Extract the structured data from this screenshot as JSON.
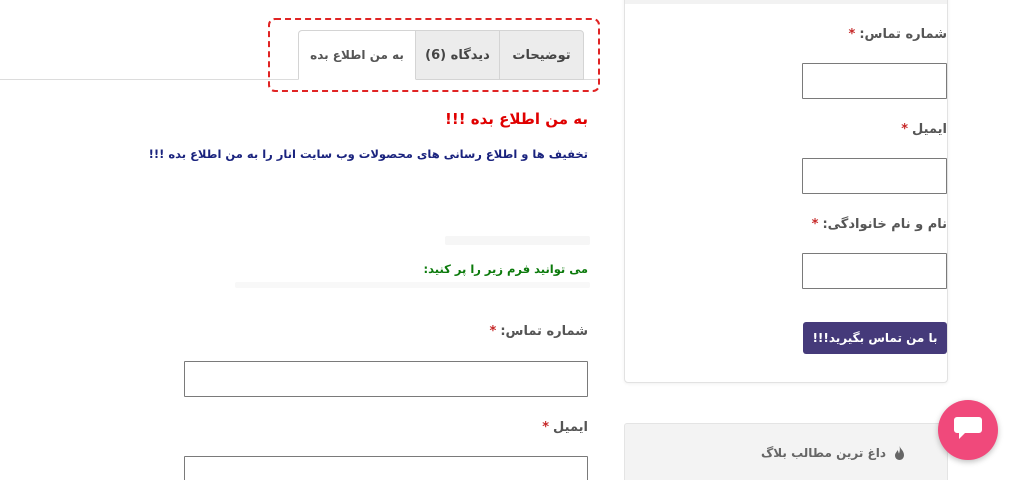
{
  "tabs": {
    "items": [
      {
        "label": "توضیحات"
      },
      {
        "label": "دیدگاه (6)"
      },
      {
        "label": "به من اطلاع بده"
      }
    ]
  },
  "notify": {
    "title": "به من اطلاع بده !!!",
    "description": "تخفیف ها و اطلاع رسانی های محصولات وب سایت انار را به من اطلاع بده !!!",
    "fill_form": "می توانید فرم زیر را پر کنید:"
  },
  "main_form": {
    "phone_label": "شماره تماس:",
    "email_label": "ایمیل",
    "required_mark": "*"
  },
  "sidebar_form": {
    "phone_label": "شماره تماس:",
    "email_label": "ایمیل",
    "name_label": "نام و نام خانوادگی:",
    "required_mark": "*",
    "submit_label": "با من تماس بگیرید!!!",
    "submit_color": "#453a7a"
  },
  "hot_posts": {
    "title": "داغ ترین مطالب بلاگ",
    "icon": "fire-icon"
  },
  "chat": {
    "icon": "chat-bubble-icon",
    "color": "#f0497b"
  },
  "colors": {
    "highlight_border": "#e02424",
    "notify_title": "#e00000",
    "notify_description": "#1a237e",
    "fill_form": "#0b7a0b"
  }
}
